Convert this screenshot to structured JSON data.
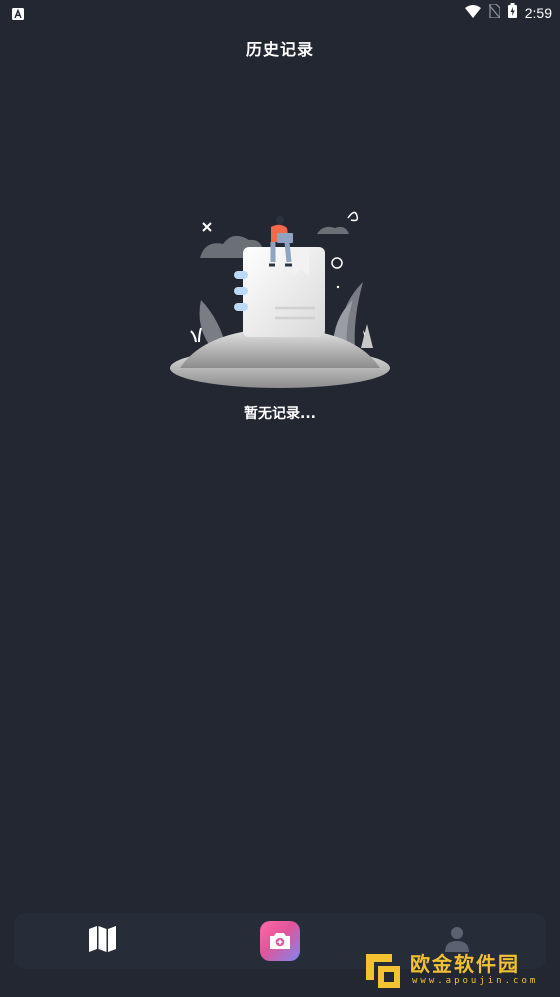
{
  "status_bar": {
    "time": "2:59",
    "icons": [
      "keyboard-a-icon",
      "wifi-icon",
      "no-sim-icon",
      "battery-charging-icon"
    ]
  },
  "header": {
    "title": "历史记录"
  },
  "empty_state": {
    "illustration": "empty-notebook-illustration",
    "message": "暂无记录..."
  },
  "bottom_nav": {
    "items": [
      {
        "icon": "map-icon",
        "active": false
      },
      {
        "icon": "camera-icon",
        "active": true
      },
      {
        "icon": "user-icon",
        "active": false
      }
    ]
  },
  "watermark": {
    "name": "欧金软件园",
    "url": "www.apoujin.com"
  },
  "colors": {
    "background": "#222731",
    "nav_background": "#272d38",
    "accent_gradient_start": "#ff6aa8",
    "accent_gradient_end": "#7f86f0",
    "watermark": "#f2c230"
  }
}
